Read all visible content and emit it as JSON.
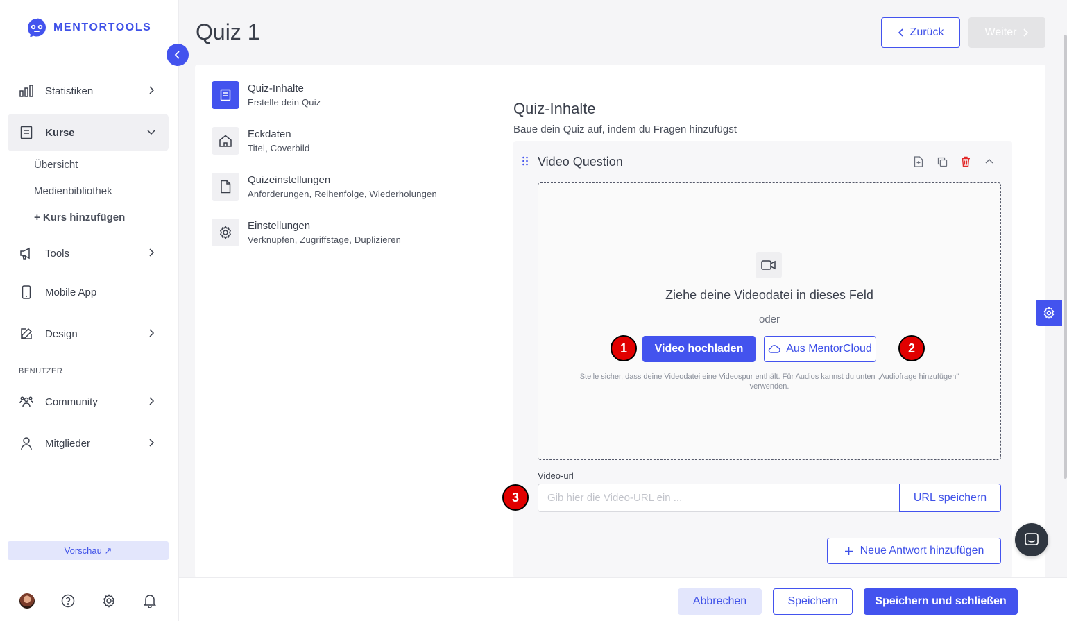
{
  "app": {
    "logo_text": "MENTORTOOLS",
    "accent": "#4353ee"
  },
  "sidebar": {
    "items": [
      {
        "label": "Statistiken",
        "icon": "bar-chart-icon"
      },
      {
        "label": "Kurse",
        "icon": "book-icon"
      },
      {
        "label": "Tools",
        "icon": "megaphone-icon"
      },
      {
        "label": "Mobile App",
        "icon": "phone-icon"
      },
      {
        "label": "Design",
        "icon": "pencil-icon"
      },
      {
        "label": "Community",
        "icon": "users-icon"
      },
      {
        "label": "Mitglieder",
        "icon": "user-icon"
      }
    ],
    "sub_items": [
      "Übersicht",
      "Medienbibliothek",
      "+ Kurs hinzufügen"
    ],
    "section_label": "BENUTZER",
    "preview_label": "Vorschau ↗"
  },
  "header": {
    "title": "Quiz 1",
    "back_label": "Zurück",
    "next_label": "Weiter"
  },
  "steps": [
    {
      "title": "Quiz-Inhalte",
      "subtitle": "Erstelle dein Quiz"
    },
    {
      "title": "Eckdaten",
      "subtitle": "Titel, Coverbild"
    },
    {
      "title": "Quizeinstellungen",
      "subtitle": "Anforderungen, Reihenfolge, Wiederholungen"
    },
    {
      "title": "Einstellungen",
      "subtitle": "Verknüpfen, Zugriffstage, Duplizieren"
    }
  ],
  "content": {
    "title": "Quiz-Inhalte",
    "subtitle": "Baue dein Quiz auf, indem du Fragen hinzufügst",
    "question": {
      "title": "Video Question",
      "dropzone": {
        "title": "Ziehe deine Videodatei in dieses Feld",
        "or": "oder",
        "upload_label": "Video hochladen",
        "cloud_label": "Aus MentorCloud",
        "note": "Stelle sicher, dass deine Videodatei eine Videospur enthält. Für Audios kannst du unten „Audiofrage hinzufügen\" verwenden."
      },
      "url_label": "Video-url",
      "url_placeholder": "Gib hier die Video-URL ein ...",
      "url_value": "",
      "url_save_label": "URL speichern",
      "new_answer_label": "Neue Antwort hinzufügen"
    }
  },
  "markers": [
    "1",
    "2",
    "3"
  ],
  "footer": {
    "cancel_label": "Abbrechen",
    "save_label": "Speichern",
    "save_close_label": "Speichern und schließen"
  }
}
